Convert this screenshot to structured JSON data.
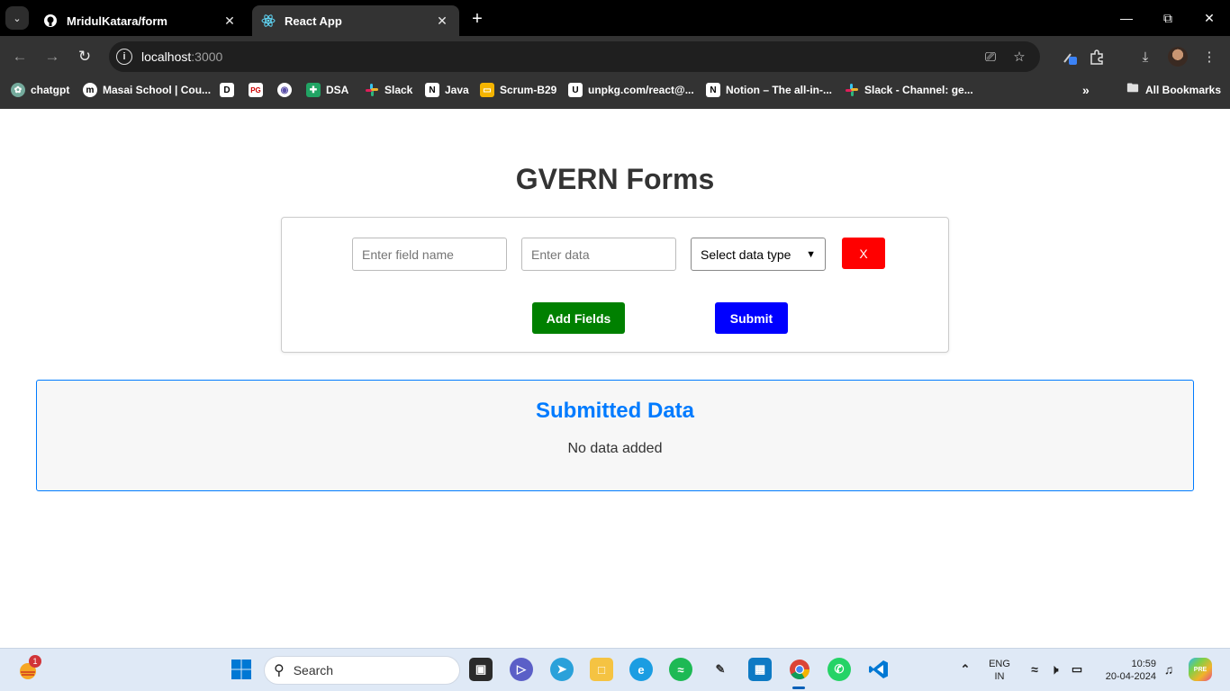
{
  "browser": {
    "tabs": [
      {
        "title": "MridulKatara/form",
        "icon": "github-icon"
      },
      {
        "title": "React App",
        "icon": "react-icon"
      }
    ],
    "url_host": "localhost",
    "url_port": ":3000",
    "bookmarks": [
      {
        "label": "chatgpt",
        "icon": "chatgpt-icon"
      },
      {
        "label": "Masai School | Cou...",
        "icon": "masai-icon"
      },
      {
        "label": "",
        "icon": "d-icon"
      },
      {
        "label": "",
        "icon": "pg-icon"
      },
      {
        "label": "",
        "icon": "circle-icon"
      },
      {
        "label": "DSA",
        "icon": "sheets-icon"
      },
      {
        "label": "Slack",
        "icon": "slack-icon"
      },
      {
        "label": "Java",
        "icon": "notion-icon"
      },
      {
        "label": "Scrum-B29",
        "icon": "slides-icon"
      },
      {
        "label": "unpkg.com/react@...",
        "icon": "unpkg-icon"
      },
      {
        "label": "Notion – The all-in-...",
        "icon": "notion-icon"
      },
      {
        "label": "Slack - Channel: ge...",
        "icon": "slack-icon"
      }
    ],
    "all_bookmarks": "All Bookmarks"
  },
  "app": {
    "title": "GVERN Forms",
    "form": {
      "field_name_placeholder": "Enter field name",
      "data_placeholder": "Enter data",
      "data_type_selected": "Select data type",
      "remove_label": "X",
      "add_label": "Add Fields",
      "submit_label": "Submit"
    },
    "submitted": {
      "title": "Submitted Data",
      "empty_text": "No data added"
    }
  },
  "taskbar": {
    "search_label": "Search",
    "notification_count": "1",
    "lang_line1": "ENG",
    "lang_line2": "IN",
    "time": "10:59",
    "date": "20-04-2024"
  },
  "colors": {
    "remove": "#ff0000",
    "add": "#008000",
    "submit": "#0000ff",
    "accent": "#007bff"
  }
}
